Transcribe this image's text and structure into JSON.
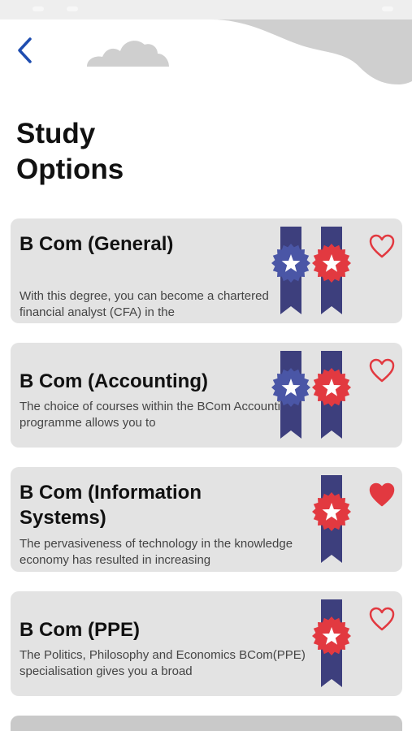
{
  "header": {
    "title": "Study\nOptions"
  },
  "colors": {
    "ribbon": "#3d3f7d",
    "badge_blue": "#4a56a6",
    "badge_red": "#e23940",
    "heart": "#e23940",
    "card_bg": "#e3e3e3",
    "back_arrow": "#1e4db0",
    "blob": "#d0d0d0"
  },
  "options": [
    {
      "title": "B Com (General)",
      "description": "With this degree, you can become a chartered financial analyst (CFA) in the",
      "badges": [
        "blue",
        "red"
      ],
      "favorite": false
    },
    {
      "title": "B Com (Accounting)",
      "description": "The choice of courses within the BCom Accounting programme allows you to",
      "badges": [
        "blue",
        "red"
      ],
      "favorite": false
    },
    {
      "title": "B Com (Information Systems)",
      "description": "The pervasiveness of technology in the knowledge economy has resulted in increasing",
      "badges": [
        "red"
      ],
      "favorite": true
    },
    {
      "title": "B Com (PPE)",
      "description": "The Politics, Philosophy and Economics BCom(PPE) specialisation gives you a broad",
      "badges": [
        "red"
      ],
      "favorite": false
    }
  ]
}
